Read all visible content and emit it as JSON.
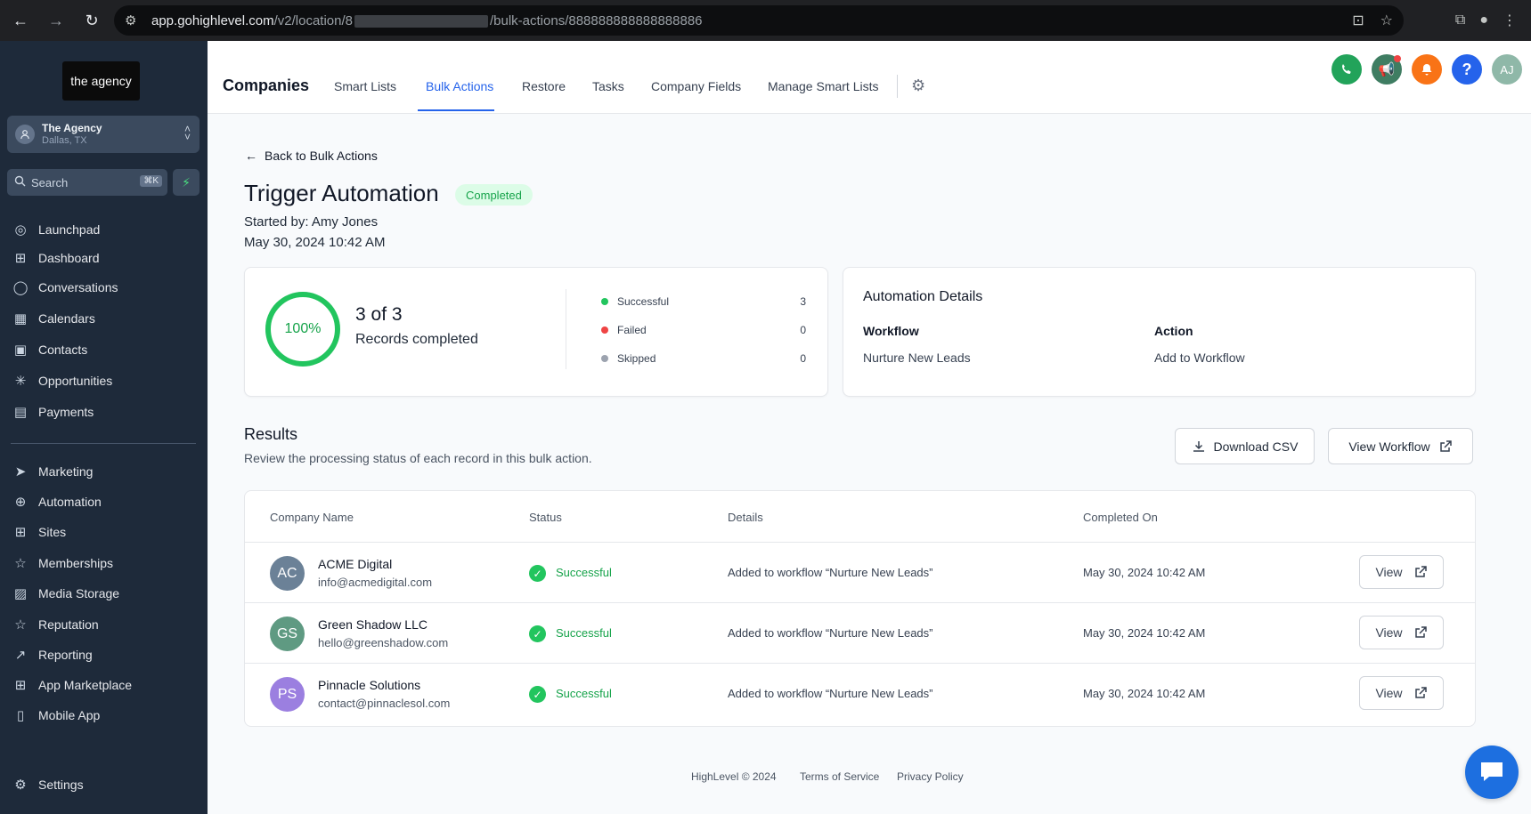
{
  "browser": {
    "url_host": "app.gohighlevel.com",
    "url_path_start": "/v2/location/8",
    "url_path_end": "/bulk-actions/888888888888888886"
  },
  "sidebar": {
    "logo_text": "the agency",
    "location": {
      "name": "The Agency",
      "sub": "Dallas, TX"
    },
    "search": {
      "label": "Search",
      "shortcut": "⌘K"
    },
    "items_top": [
      {
        "label": "Launchpad",
        "icon": "launchpad-icon"
      },
      {
        "label": "Dashboard",
        "icon": "dashboard-icon"
      },
      {
        "label": "Conversations",
        "icon": "chat-icon"
      },
      {
        "label": "Calendars",
        "icon": "calendar-icon"
      },
      {
        "label": "Contacts",
        "icon": "contacts-icon"
      },
      {
        "label": "Opportunities",
        "icon": "opportunities-icon"
      },
      {
        "label": "Payments",
        "icon": "payments-icon"
      }
    ],
    "items_bottom": [
      {
        "label": "Marketing",
        "icon": "send-icon"
      },
      {
        "label": "Automation",
        "icon": "automation-icon"
      },
      {
        "label": "Sites",
        "icon": "sites-icon"
      },
      {
        "label": "Memberships",
        "icon": "memberships-icon"
      },
      {
        "label": "Media Storage",
        "icon": "image-icon"
      },
      {
        "label": "Reputation",
        "icon": "star-icon"
      },
      {
        "label": "Reporting",
        "icon": "trend-icon"
      },
      {
        "label": "App Marketplace",
        "icon": "grid-icon"
      },
      {
        "label": "Mobile App",
        "icon": "phone-icon"
      }
    ],
    "settings_label": "Settings"
  },
  "header": {
    "title": "Companies",
    "tabs": [
      "Smart Lists",
      "Bulk Actions",
      "Restore",
      "Tasks",
      "Company Fields",
      "Manage Smart Lists"
    ],
    "active_tab": "Bulk Actions",
    "avatar_initials": "AJ",
    "help_label": "?"
  },
  "main": {
    "back_label": "Back to Bulk Actions",
    "title": "Trigger Automation",
    "status": "Completed",
    "started_by": "Started by: Amy Jones",
    "started_date": "May 30, 2024 10:42 AM"
  },
  "summary": {
    "percent_label": "100%",
    "progress_fraction": 1.0,
    "count_label": "3 of 3",
    "records_label": "Records completed",
    "stats": [
      {
        "label": "Successful",
        "value": "3",
        "color": "#22c55e"
      },
      {
        "label": "Failed",
        "value": "0",
        "color": "#ef4444"
      },
      {
        "label": "Skipped",
        "value": "0",
        "color": "#9ca3af"
      }
    ]
  },
  "automation": {
    "title": "Automation Details",
    "workflow_label": "Workflow",
    "workflow_value": "Nurture New Leads",
    "action_label": "Action",
    "action_value": "Add to Workflow"
  },
  "results": {
    "title": "Results",
    "subtitle": "Review the processing status of each record in this bulk action.",
    "download_label": "Download CSV",
    "view_workflow_label": "View Workflow",
    "columns": [
      "Company Name",
      "Status",
      "Details",
      "Completed On"
    ],
    "rows": [
      {
        "initials": "AC",
        "color": "#6b8197",
        "name": "ACME Digital",
        "email": "info@acmedigital.com",
        "status": "Successful",
        "details": "Added to workflow “Nurture New Leads”",
        "completed": "May 30, 2024 10:42 AM",
        "view_label": "View"
      },
      {
        "initials": "GS",
        "color": "#5f9a82",
        "name": "Green Shadow LLC",
        "email": "hello@greenshadow.com",
        "status": "Successful",
        "details": "Added to workflow “Nurture New Leads”",
        "completed": "May 30, 2024 10:42 AM",
        "view_label": "View"
      },
      {
        "initials": "PS",
        "color": "#9b7fe0",
        "name": "Pinnacle Solutions",
        "email": "contact@pinnaclesol.com",
        "status": "Successful",
        "details": "Added to workflow “Nurture New Leads”",
        "completed": "May 30, 2024 10:42 AM",
        "view_label": "View"
      }
    ]
  },
  "footer": {
    "copyright": "HighLevel © 2024",
    "terms": "Terms of Service",
    "privacy": "Privacy Policy"
  },
  "colors": {
    "accent": "#2563eb",
    "success": "#22c55e",
    "sidebar_bg": "#1e2a3a"
  }
}
